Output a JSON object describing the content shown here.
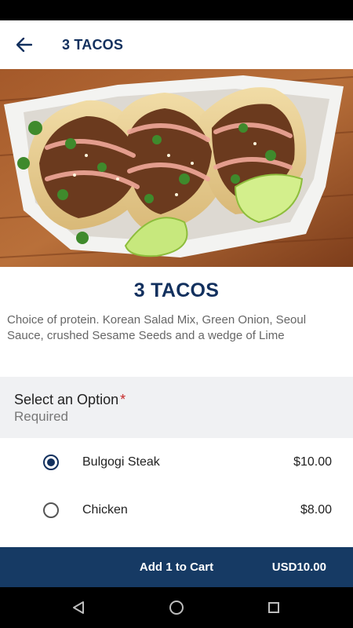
{
  "app_bar": {
    "title": "3 TACOS",
    "back_icon": "arrow-left-icon"
  },
  "hero": {
    "image": "tacos-photo"
  },
  "item": {
    "title": "3 TACOS",
    "description": "Choice of protein. Korean Salad Mix, Green Onion, Seoul Sauce, crushed Sesame Seeds and a wedge of Lime"
  },
  "option_group": {
    "title": "Select an Option",
    "required_mark": "*",
    "subtitle": "Required",
    "options": [
      {
        "name": "Bulgogi Steak",
        "price": "$10.00",
        "selected": true
      },
      {
        "name": "Chicken",
        "price": "$8.00",
        "selected": false
      }
    ]
  },
  "cart": {
    "label": "Add 1 to Cart",
    "total": "USD10.00"
  },
  "nav": {
    "back_icon": "triangle-back-icon",
    "home_icon": "circle-home-icon",
    "recents_icon": "square-recents-icon"
  },
  "colors": {
    "primary": "#12305e",
    "cart_bar": "#163a64",
    "required_star": "#c62828",
    "option_header_bg": "#f0f1f3"
  }
}
